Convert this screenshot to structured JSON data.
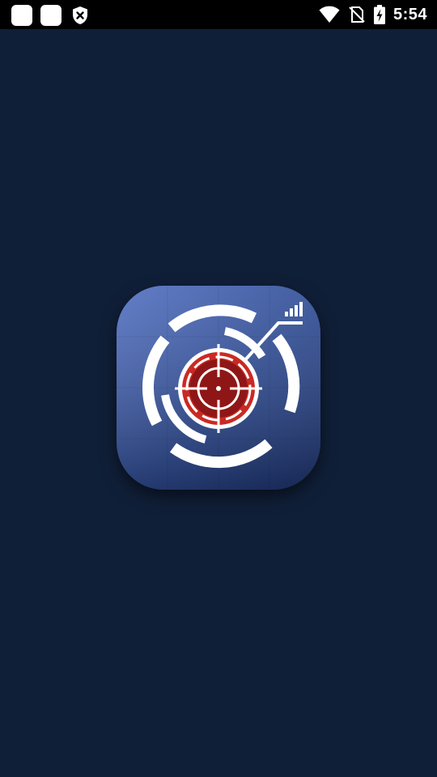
{
  "status_bar": {
    "time": "5:54",
    "left_icons": [
      "notification-square-icon",
      "notification-square-icon",
      "shield-x-icon"
    ],
    "right_icons": [
      "wifi-icon",
      "no-sim-icon",
      "battery-charging-icon"
    ]
  },
  "splash": {
    "logo": "crosshair-target-app-logo",
    "colors": {
      "background": "#101f38",
      "logo_blue": "#3a5fb5",
      "logo_red": "#b3201f"
    }
  }
}
